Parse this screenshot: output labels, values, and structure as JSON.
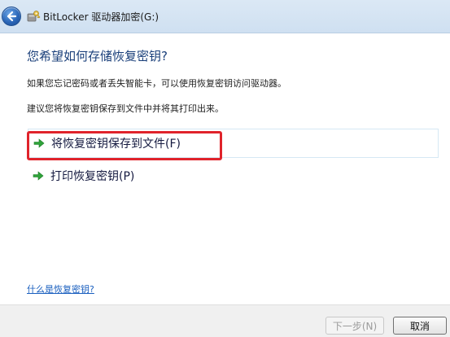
{
  "window": {
    "title": "BitLocker 驱动器加密(G:)",
    "back_icon": "back-arrow-icon",
    "app_icon": "bitlocker-key-icon"
  },
  "main": {
    "heading": "您希望如何存储恢复密钥?",
    "description_1": "如果您忘记密码或者丢失智能卡，可以使用恢复密钥访问驱动器。",
    "description_2": "建议您将恢复密钥保存到文件中并将其打印出来。",
    "options": [
      {
        "label": "将恢复密钥保存到文件(F)",
        "icon": "green-arrow-icon"
      },
      {
        "label": "打印恢复密钥(P)",
        "icon": "green-arrow-icon"
      }
    ],
    "help_link": "什么是恢复密钥?"
  },
  "footer": {
    "next_label": "下一步(N)",
    "cancel_label": "取消"
  },
  "colors": {
    "heading": "#1a3f7a",
    "highlight": "#e0232b",
    "link": "#1a5fbf",
    "arrow": "#2fa33a"
  }
}
